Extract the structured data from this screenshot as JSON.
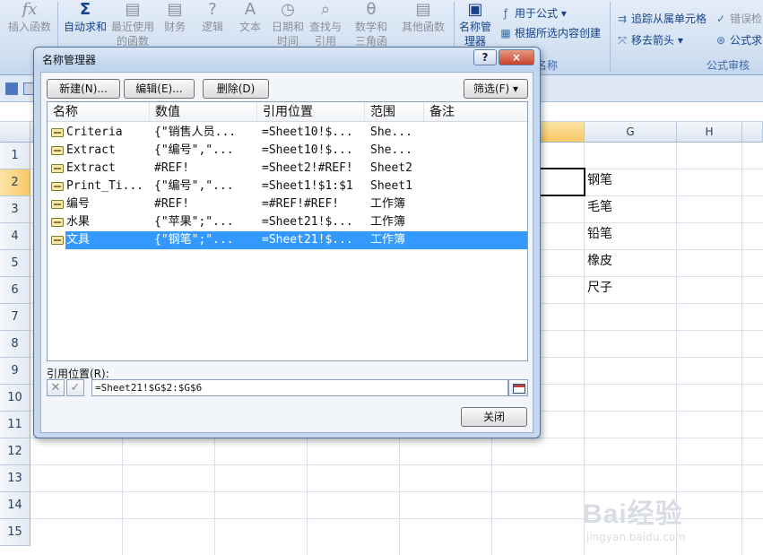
{
  "ribbon": {
    "buttons": [
      {
        "label": "插入函数",
        "icon": "fx-icon"
      },
      {
        "label": "自动求和",
        "icon": "sigma-icon"
      },
      {
        "label": "最近使用的函数",
        "icon": "book-icon"
      },
      {
        "label": "财务",
        "icon": "book-icon"
      },
      {
        "label": "逻辑",
        "icon": "question-book-icon"
      },
      {
        "label": "文本",
        "icon": "text-book-icon"
      },
      {
        "label": "日期和时间",
        "icon": "clock-book-icon"
      },
      {
        "label": "查找与引用",
        "icon": "search-book-icon"
      },
      {
        "label": "数学和三角函数",
        "icon": "theta-book-icon"
      },
      {
        "label": "其他函数",
        "icon": "book-icon"
      },
      {
        "label": "名称管理器",
        "icon": "name-manager-icon"
      }
    ],
    "name_group": {
      "use_in_formula": "用于公式",
      "create_from_selection": "根据所选内容创建",
      "label": "名称"
    },
    "audit_group": {
      "trace_dependents": "追踪从属单元格",
      "remove_arrows": "移去箭头",
      "error_checking": "错误检",
      "formulas": "公式求",
      "label": "公式审核"
    }
  },
  "grid": {
    "columns": [
      "G",
      "H"
    ],
    "rows": [
      "1",
      "2",
      "3",
      "4",
      "5",
      "6",
      "7",
      "8",
      "9",
      "10",
      "11",
      "12",
      "13",
      "14",
      "15"
    ],
    "g_values": [
      "钢笔",
      "毛笔",
      "铅笔",
      "橡皮",
      "尺子"
    ]
  },
  "dialog": {
    "title": "名称管理器",
    "help": "?",
    "close": "×",
    "buttons": {
      "new": "新建(N)...",
      "edit": "编辑(E)...",
      "delete": "删除(D)",
      "filter": "筛选(F)"
    },
    "columns": [
      "名称",
      "数值",
      "引用位置",
      "范围",
      "备注"
    ],
    "rows": [
      {
        "name": "Criteria",
        "value": "{\"销售人员...",
        "ref": "=Sheet10!$...",
        "scope": "She...",
        "note": ""
      },
      {
        "name": "Extract",
        "value": "{\"编号\",\"...",
        "ref": "=Sheet10!$...",
        "scope": "She...",
        "note": ""
      },
      {
        "name": "Extract",
        "value": "#REF!",
        "ref": "=Sheet2!#REF!",
        "scope": "Sheet2",
        "note": ""
      },
      {
        "name": "Print_Ti...",
        "value": "{\"编号\",\"...",
        "ref": "=Sheet1!$1:$1",
        "scope": "Sheet1",
        "note": ""
      },
      {
        "name": "编号",
        "value": "#REF!",
        "ref": "=#REF!#REF!",
        "scope": "工作簿",
        "note": ""
      },
      {
        "name": "水果",
        "value": "{\"苹果\";\"...",
        "ref": "=Sheet21!$...",
        "scope": "工作簿",
        "note": ""
      },
      {
        "name": "文具",
        "value": "{\"钢笔\";\"...",
        "ref": "=Sheet21!$...",
        "scope": "工作簿",
        "note": ""
      }
    ],
    "selected_row": 6,
    "ref_label": "引用位置(R):",
    "ref_value": "=Sheet21!$G$2:$G$6",
    "close_button": "关闭"
  },
  "watermark": {
    "brand": "Bai经验",
    "url": "jingyan.baidu.com"
  }
}
